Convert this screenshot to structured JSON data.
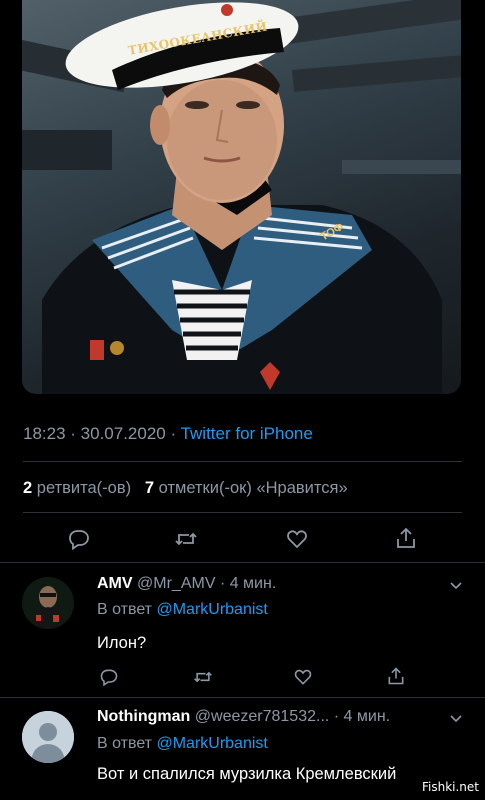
{
  "photo": {
    "cap_band_text": "ТИХООКЕАНСКИЙ",
    "collar_text": "ТОФ"
  },
  "tweet_meta": {
    "time": "18:23",
    "separator": " · ",
    "date": "30.07.2020",
    "source": "Twitter for iPhone"
  },
  "stats": {
    "retweets_count": "2",
    "retweets_label": "ретвита(-ов)",
    "likes_count": "7",
    "likes_label": "отметки(-ок) «Нравится»"
  },
  "actions": [
    "reply-icon",
    "retweet-icon",
    "like-icon",
    "share-icon"
  ],
  "replies": [
    {
      "name": "AMV",
      "handle": "@Mr_AMV",
      "time": "· 4 мин.",
      "reply_prefix": "В ответ",
      "mention": "@MarkUrbanist",
      "text": "Илон?"
    },
    {
      "name": "Nothingman",
      "handle": "@weezer781532...",
      "time": "· 4 мин.",
      "reply_prefix": "В ответ",
      "mention": "@MarkUrbanist",
      "text": "Вот и спалился мурзилка Кремлевский"
    }
  ],
  "colors": {
    "background": "#000000",
    "accent": "#1d9bf0",
    "secondary_text": "#8b98a5",
    "divider": "#2f3336"
  },
  "watermark": "Fishki.net"
}
